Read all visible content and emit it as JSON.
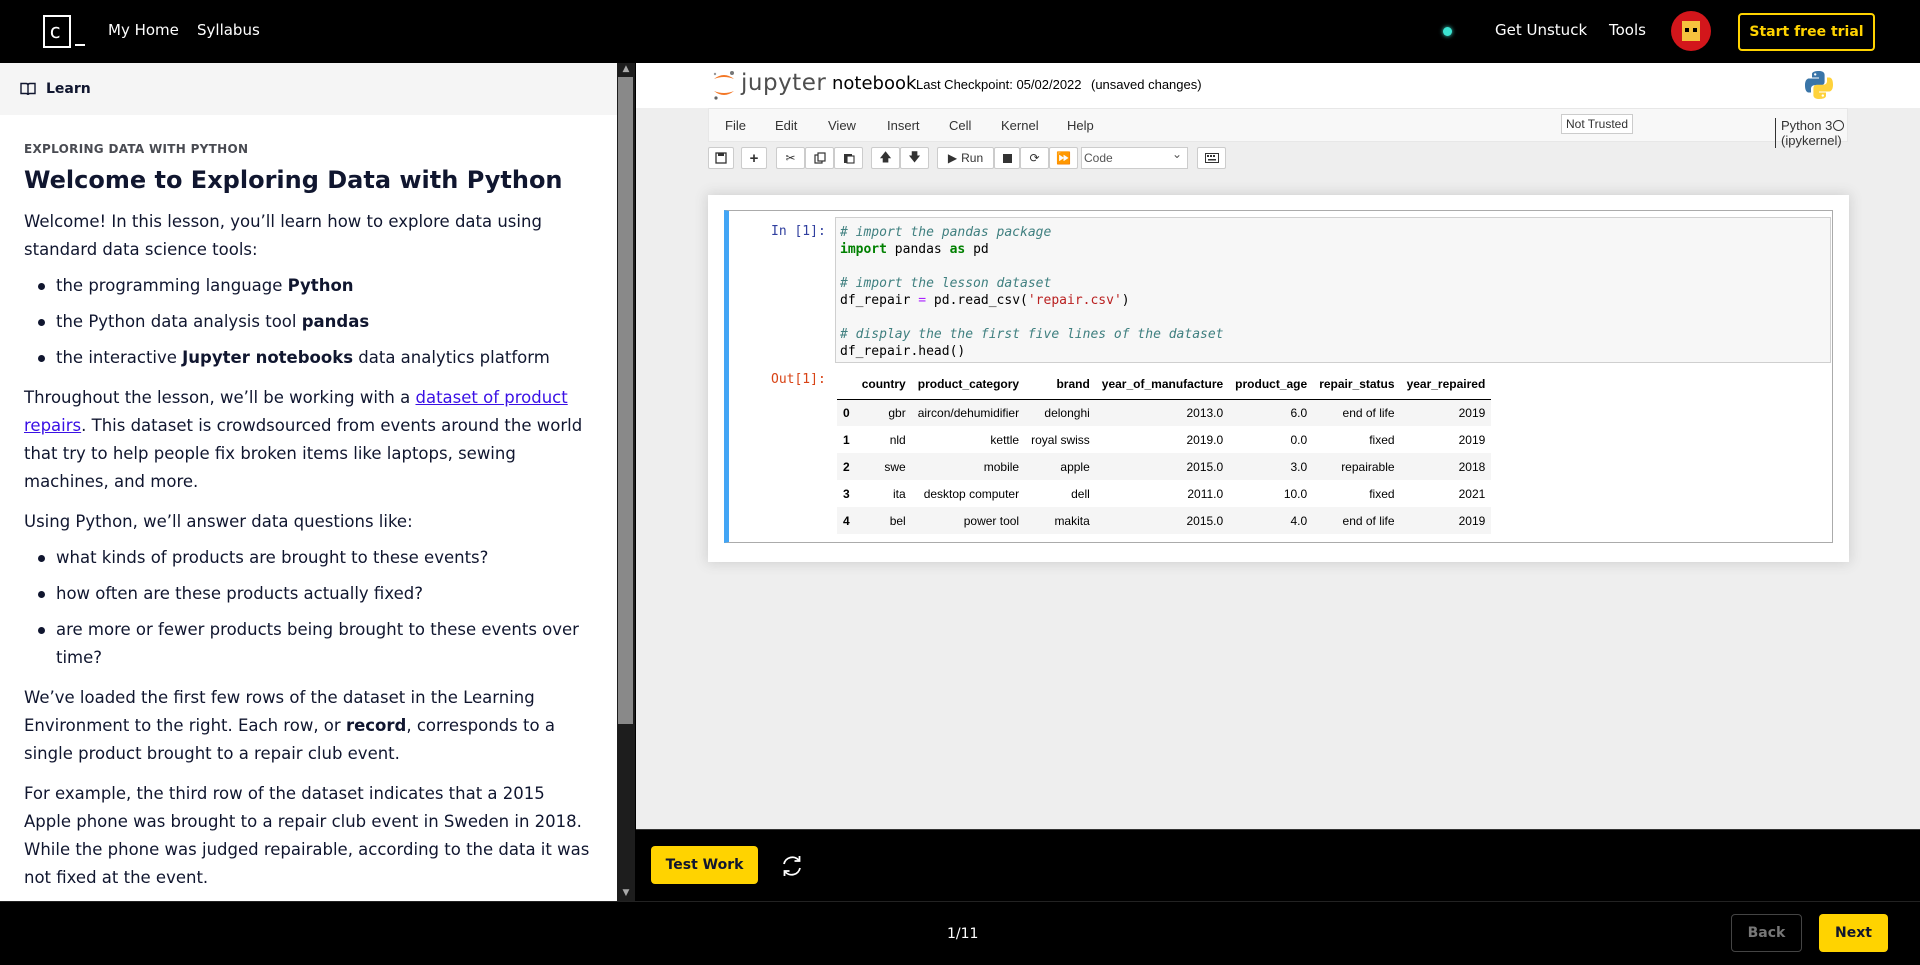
{
  "topbar": {
    "nav": [
      "My Home",
      "Syllabus"
    ],
    "get_unstuck": "Get Unstuck",
    "tools": "Tools",
    "start_trial": "Start free trial",
    "status_color": "#3ce4d2",
    "accent": "#ffd300"
  },
  "learn": {
    "header": "Learn",
    "eyebrow": "EXPLORING DATA WITH PYTHON",
    "title": "Welcome to Exploring Data with Python",
    "intro": "Welcome! In this lesson, you’ll learn how to explore data using standard data science tools:",
    "tools": [
      {
        "pre": "the programming language ",
        "bold": "Python",
        "post": ""
      },
      {
        "pre": "the Python data analysis tool ",
        "bold": "pandas",
        "post": ""
      },
      {
        "pre": "the interactive ",
        "bold": "Jupyter notebooks",
        "post": " data analytics platform"
      }
    ],
    "dataset_pre": "Throughout the lesson, we’ll be working with a ",
    "dataset_link": "dataset of product repairs",
    "dataset_post": ". This dataset is crowdsourced from events around the world that try to help people fix broken items like laptops, sewing machines, and more.",
    "questions_intro": "Using Python, we’ll answer data questions like:",
    "questions": [
      "what kinds of products are brought to these events?",
      "how often are these products actually fixed?",
      "are more or fewer products being brought to these events over time?"
    ],
    "loaded_pre": "We’ve loaded the first few rows of the dataset in the Learning Environment to the right. Each row, or ",
    "loaded_bold": "record",
    "loaded_post": ", corresponds to a single product brought to a repair club event.",
    "example": "For example, the third row of the dataset indicates that a 2015 Apple phone was brought to a repair club event in Sweden in 2018. While the phone was judged repairable, according to the data it was not fixed at the event."
  },
  "jupyter": {
    "logo_text": "jupyter",
    "notebook_name": "notebook",
    "checkpoint": "Last Checkpoint: 05/02/2022",
    "unsaved": "(unsaved changes)",
    "menu": [
      "File",
      "Edit",
      "View",
      "Insert",
      "Cell",
      "Kernel",
      "Help"
    ],
    "trust": "Not Trusted",
    "kernel": "Python 3 (ipykernel)",
    "run_label": "Run",
    "cell_type": "Code",
    "in_prompt": "In [1]:",
    "out_prompt": "Out[1]:",
    "code": {
      "c1": "# import the pandas package",
      "kw_import": "import",
      "l2_mid": " pandas ",
      "kw_as": "as",
      "l2_end": " pd",
      "c2": "# import the lesson dataset",
      "l3_pre": "df_repair ",
      "l3_eq": "=",
      "l3_mid": " pd.read_csv(",
      "l3_str": "'repair.csv'",
      "l3_end": ")",
      "c3": "# display the the first five lines of the dataset",
      "l4": "df_repair.head()"
    },
    "table": {
      "columns": [
        "",
        "country",
        "product_category",
        "brand",
        "year_of_manufacture",
        "product_age",
        "repair_status",
        "year_repaired"
      ],
      "rows": [
        [
          "0",
          "gbr",
          "aircon/dehumidifier",
          "delonghi",
          "2013.0",
          "6.0",
          "end of life",
          "2019"
        ],
        [
          "1",
          "nld",
          "kettle",
          "royal swiss",
          "2019.0",
          "0.0",
          "fixed",
          "2019"
        ],
        [
          "2",
          "swe",
          "mobile",
          "apple",
          "2015.0",
          "3.0",
          "repairable",
          "2018"
        ],
        [
          "3",
          "ita",
          "desktop computer",
          "dell",
          "2011.0",
          "10.0",
          "fixed",
          "2021"
        ],
        [
          "4",
          "bel",
          "power tool",
          "makita",
          "2015.0",
          "4.0",
          "end of life",
          "2019"
        ]
      ]
    }
  },
  "actions": {
    "test_work": "Test Work"
  },
  "footer": {
    "progress": "1/11",
    "back": "Back",
    "next": "Next"
  }
}
